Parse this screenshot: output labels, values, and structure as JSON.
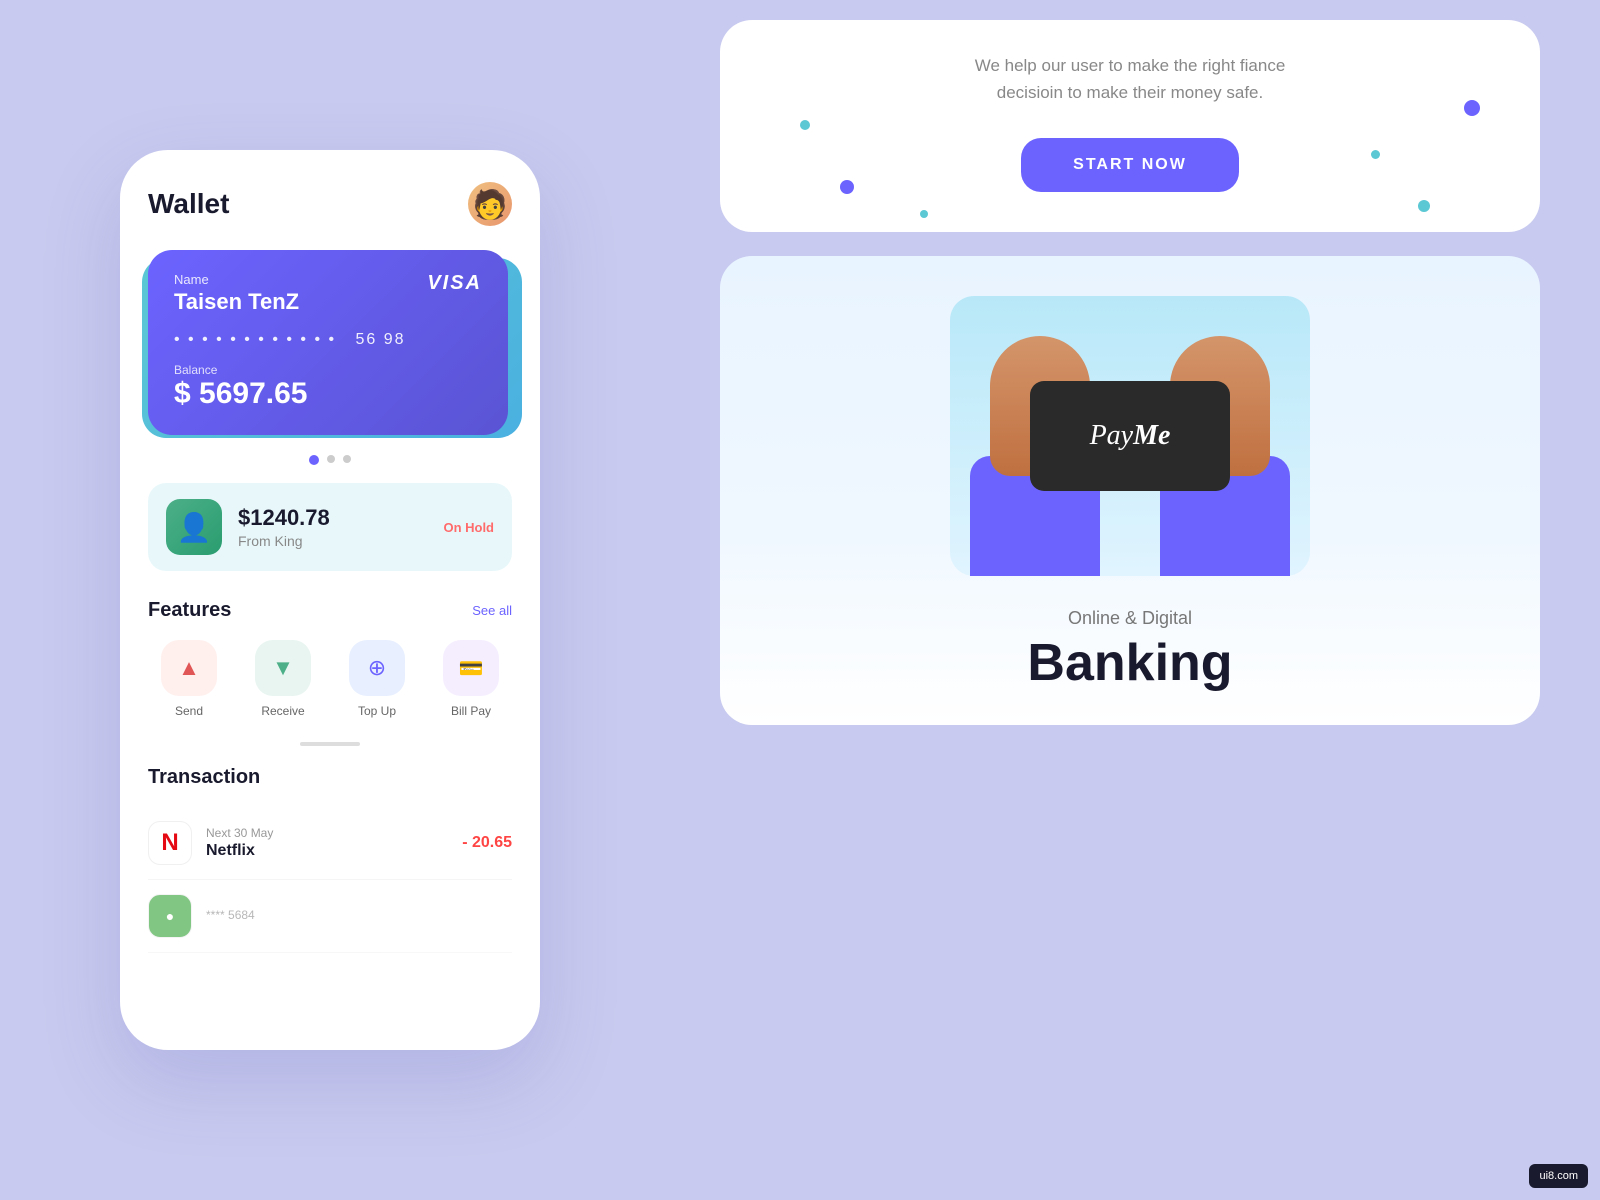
{
  "left_panel": {
    "phone": {
      "wallet_title": "Wallet",
      "card": {
        "label": "Name",
        "name": "Taisen TenZ",
        "number_masked": "• • • •   • • • •   • • • •",
        "number_last4": "56 98",
        "balance_label": "Balance",
        "balance": "$ 5697.65",
        "brand": "VISA"
      },
      "on_hold": {
        "amount": "$1240.78",
        "from_label": "From King",
        "badge": "On Hold"
      },
      "features": {
        "title": "Features",
        "see_all": "See all",
        "items": [
          {
            "label": "Send",
            "icon": "↑",
            "color": "send"
          },
          {
            "label": "Receive",
            "icon": "↓",
            "color": "receive"
          },
          {
            "label": "Top Up",
            "icon": "⊕",
            "color": "topup"
          },
          {
            "label": "Bill Pay",
            "icon": "💳",
            "color": "billpay"
          }
        ]
      },
      "transactions": {
        "title": "Transaction",
        "items": [
          {
            "logo": "N",
            "subtitle": "Next 30 May",
            "name": "Netflix",
            "amount": "- 20.65",
            "logo_type": "netflix"
          },
          {
            "logo": "****",
            "subtitle": "**** 5684",
            "name": "",
            "amount": "",
            "logo_type": "green"
          }
        ]
      }
    }
  },
  "right_panel": {
    "top_card": {
      "subtitle_line1": "We help our user to make the right fiance",
      "subtitle_line2": "decisioin to make their money safe.",
      "cta_button": "START NOW"
    },
    "payme_card": {
      "phone_text_1": "Pay",
      "phone_text_2": "Me",
      "online_label": "Online & Digital",
      "banking_title": "Banking"
    }
  },
  "icons": {
    "send_icon": "▲",
    "receive_icon": "▼",
    "topup_icon": "⊕",
    "billpay_icon": "◈",
    "netflix_letter": "N"
  },
  "colors": {
    "purple": "#6c63ff",
    "card_gradient_start": "#6c63ff",
    "card_gradient_end": "#5a54d4",
    "background": "#c8caef",
    "red_amount": "#ff4444",
    "on_hold_red": "#ff6b6b"
  }
}
